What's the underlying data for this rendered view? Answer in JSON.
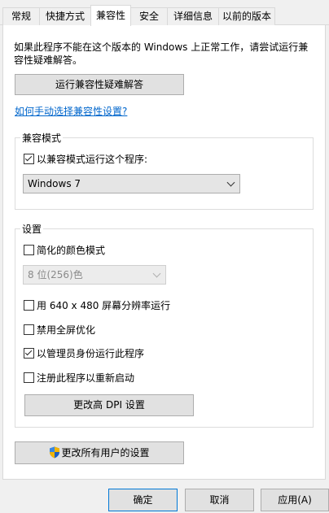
{
  "tabs": [
    {
      "label": "常规"
    },
    {
      "label": "快捷方式"
    },
    {
      "label": "兼容性"
    },
    {
      "label": "安全"
    },
    {
      "label": "详细信息"
    },
    {
      "label": "以前的版本"
    }
  ],
  "intro_text": "如果此程序不能在这个版本的 Windows 上正常工作，请尝试运行兼容性疑难解答。",
  "troubleshoot_button": "运行兼容性疑难解答",
  "manual_link": "如何手动选择兼容性设置?",
  "compat_mode": {
    "title": "兼容模式",
    "checkbox_label": "以兼容模式运行这个程序:",
    "checkbox_checked": true,
    "os_selected": "Windows 7"
  },
  "settings": {
    "title": "设置",
    "reduced_color_label": "简化的颜色模式",
    "reduced_color_checked": false,
    "color_selected": "8 位(256)色",
    "res640_label": "用 640 x 480 屏幕分辨率运行",
    "res640_checked": false,
    "fullscreen_opt_label": "禁用全屏优化",
    "fullscreen_opt_checked": false,
    "admin_label": "以管理员身份运行此程序",
    "admin_checked": true,
    "restart_label": "注册此程序以重新启动",
    "restart_checked": false,
    "dpi_button": "更改高 DPI 设置"
  },
  "all_users_button": "更改所有用户的设置",
  "buttons": {
    "ok": "确定",
    "cancel": "取消",
    "apply": "应用(A)"
  }
}
